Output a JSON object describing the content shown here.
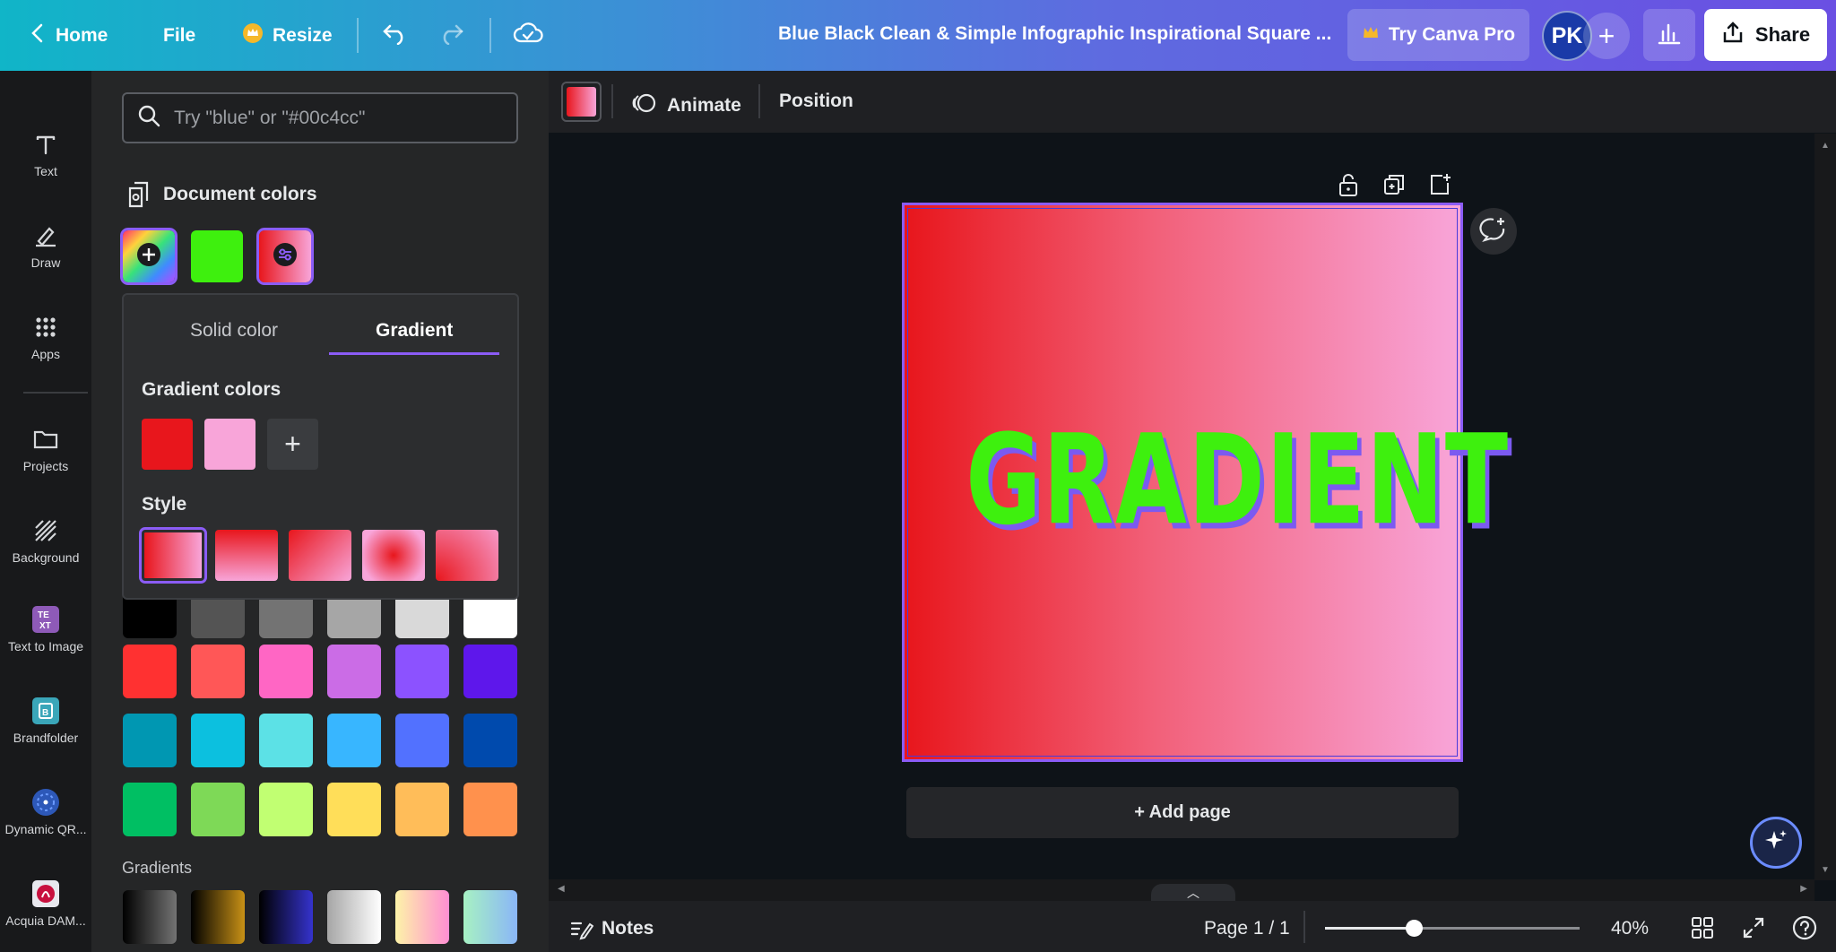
{
  "topbar": {
    "home": "Home",
    "file": "File",
    "resize": "Resize",
    "title": "Blue Black Clean & Simple Infographic Inspirational Square ...",
    "try_pro": "Try Canva Pro",
    "avatar_initials": "PK",
    "share": "Share"
  },
  "rail": {
    "items": [
      {
        "label": "Text",
        "icon": "text-icon"
      },
      {
        "label": "Draw",
        "icon": "draw-icon"
      },
      {
        "label": "Apps",
        "icon": "apps-icon"
      },
      {
        "label": "Projects",
        "icon": "folder-icon"
      },
      {
        "label": "Background",
        "icon": "background-icon"
      },
      {
        "label": "Text to Image",
        "icon": "text-to-image-icon"
      },
      {
        "label": "Brandfolder",
        "icon": "brandfolder-icon"
      },
      {
        "label": "Dynamic QR...",
        "icon": "qr-icon"
      },
      {
        "label": "Acquia DAM...",
        "icon": "acquia-icon"
      }
    ]
  },
  "panel": {
    "search_placeholder": "Try \"blue\" or \"#00c4cc\"",
    "document_colors_title": "Document colors",
    "document_colors": [
      "#3ef00e"
    ],
    "popover": {
      "tab_solid": "Solid color",
      "tab_gradient": "Gradient",
      "active_tab": "Gradient",
      "gradient_colors_title": "Gradient colors",
      "gradient_colors": [
        "#e8161c",
        "#f8a5d9"
      ],
      "style_title": "Style",
      "selected_style": 0
    },
    "default_colors": [
      [
        "#000000",
        "#545454",
        "#737373",
        "#a6a6a6",
        "#d9d9d9",
        "#ffffff"
      ],
      [
        "#ff3131",
        "#ff5757",
        "#ff66c4",
        "#cb6ce6",
        "#8c52ff",
        "#5e17eb"
      ],
      [
        "#0097b2",
        "#0cc0df",
        "#5ce1e6",
        "#38b6ff",
        "#5271ff",
        "#004aad"
      ],
      [
        "#00bf63",
        "#7ed957",
        "#c1ff72",
        "#ffde59",
        "#ffbd59",
        "#ff914d"
      ]
    ],
    "gradients_title": "Gradients"
  },
  "context_bar": {
    "animate": "Animate",
    "position": "Position"
  },
  "canvas": {
    "design_text": "GRADIENT",
    "text_color": "#3ef00e",
    "gradient_start": "#e8161c",
    "gradient_end": "#f8a5d9",
    "selection_color": "#8b5cf6",
    "add_page": "+ Add page"
  },
  "bottombar": {
    "notes": "Notes",
    "page_indicator": "Page 1 / 1",
    "zoom": "40%"
  }
}
